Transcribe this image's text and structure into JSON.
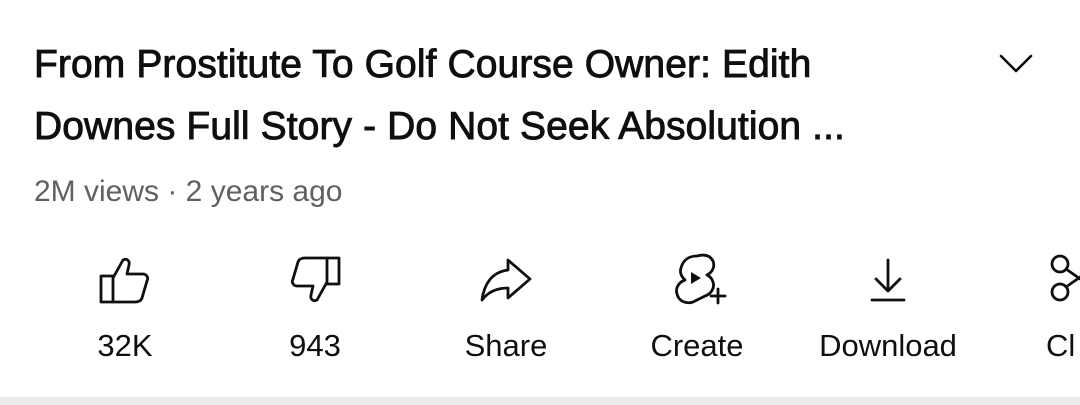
{
  "video": {
    "title_line1": "From Prostitute To Golf Course Owner: Edith",
    "title_line2": "Downes Full Story - Do Not Seek Absolution ...",
    "meta": "2M views · 2 years ago",
    "expand_icon": "chevron-down-icon"
  },
  "actions": [
    {
      "label": "32K",
      "icon": "like-icon"
    },
    {
      "label": "943",
      "icon": "dislike-icon"
    },
    {
      "label": "Share",
      "icon": "share-icon"
    },
    {
      "label": "Create",
      "icon": "create-icon"
    },
    {
      "label": "Download",
      "icon": "download-icon"
    },
    {
      "label": "Cl",
      "icon": "clip-icon"
    }
  ]
}
